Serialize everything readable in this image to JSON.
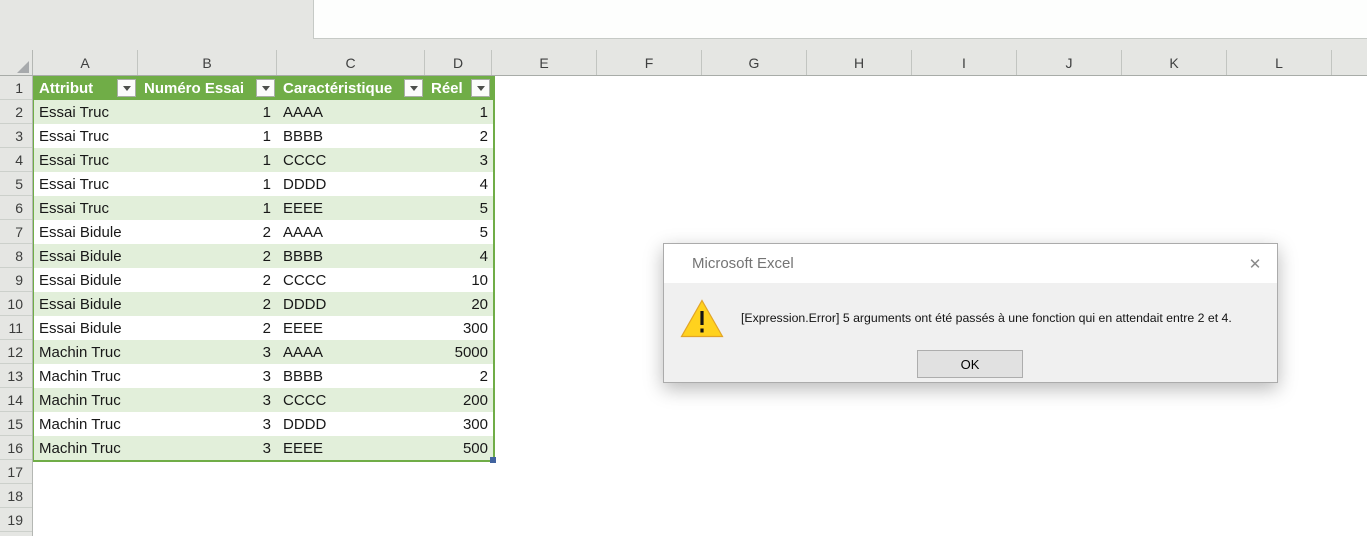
{
  "sheet": {
    "column_letters": [
      "A",
      "B",
      "C",
      "D",
      "E",
      "F",
      "G",
      "H",
      "I",
      "J",
      "K",
      "L"
    ],
    "row_numbers": [
      "1",
      "2",
      "3",
      "4",
      "5",
      "6",
      "7",
      "8",
      "9",
      "10",
      "11",
      "12",
      "13",
      "14",
      "15",
      "16",
      "17",
      "18",
      "19"
    ],
    "table": {
      "headers": [
        "Attribut",
        "Numéro Essai",
        "Caractéristique",
        "Réel"
      ],
      "rows": [
        [
          "Essai Truc",
          "1",
          "AAAA",
          "1"
        ],
        [
          "Essai Truc",
          "1",
          "BBBB",
          "2"
        ],
        [
          "Essai Truc",
          "1",
          "CCCC",
          "3"
        ],
        [
          "Essai Truc",
          "1",
          "DDDD",
          "4"
        ],
        [
          "Essai Truc",
          "1",
          "EEEE",
          "5"
        ],
        [
          "Essai Bidule",
          "2",
          "AAAA",
          "5"
        ],
        [
          "Essai Bidule",
          "2",
          "BBBB",
          "4"
        ],
        [
          "Essai Bidule",
          "2",
          "CCCC",
          "10"
        ],
        [
          "Essai Bidule",
          "2",
          "DDDD",
          "20"
        ],
        [
          "Essai Bidule",
          "2",
          "EEEE",
          "300"
        ],
        [
          "Machin Truc",
          "3",
          "AAAA",
          "5000"
        ],
        [
          "Machin Truc",
          "3",
          "BBBB",
          "2"
        ],
        [
          "Machin Truc",
          "3",
          "CCCC",
          "200"
        ],
        [
          "Machin Truc",
          "3",
          "DDDD",
          "300"
        ],
        [
          "Machin Truc",
          "3",
          "EEEE",
          "500"
        ]
      ]
    }
  },
  "dialog": {
    "title": "Microsoft Excel",
    "message": "[Expression.Error] 5 arguments ont été passés à une fonction qui en attendait entre 2 et 4.",
    "ok_label": "OK",
    "close_label": "✕"
  },
  "colors": {
    "table_header_green": "#70AD47",
    "table_band_green": "#E2EFDA",
    "selection_handle_blue": "#41639F",
    "warning_yellow": "#FFD21E"
  }
}
